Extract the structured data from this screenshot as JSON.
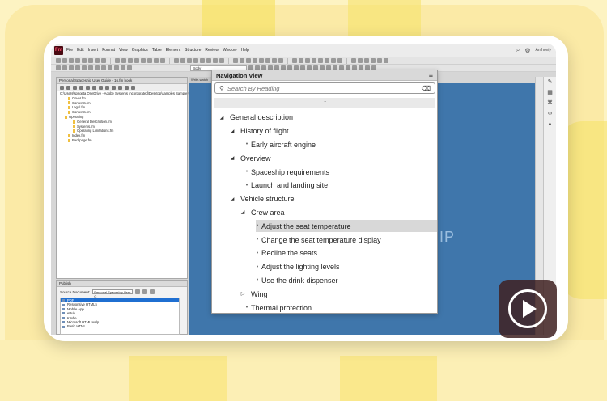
{
  "app": {
    "logo_text": "Fm",
    "menu": [
      "File",
      "Edit",
      "Insert",
      "Format",
      "View",
      "Graphics",
      "Table",
      "Element",
      "Structure",
      "Review",
      "Window",
      "Help"
    ],
    "user": "Anthoniy"
  },
  "toolbar": {
    "paragraph_style": "Body"
  },
  "book_panel": {
    "title": "Personal Spaceship User Guide - 16.fm book",
    "items": [
      "C:\\Users\\sprigeta OneDrive - Adobe Systems Incorporated\\Desktop\\samples Sample User Guide",
      "Cover.fm",
      "Contents.fm",
      "Legal.fm",
      "Contents.fm",
      "Operating",
      "General Description.fm",
      "Systems.fm",
      "Operating Limitations.fm",
      "Index.fm",
      "Backpage.fm"
    ]
  },
  "publish_panel": {
    "title": "Publish",
    "source_label": "Source Document:",
    "source_value": "Personal Spaceship User G",
    "outputs": [
      "PDF",
      "Responsive HTML5",
      "Mobile App",
      "ePub",
      "Kindle",
      "Microsoft HTML Help",
      "Basic HTML"
    ]
  },
  "document": {
    "tab": "Write-watch",
    "background_text": "IP"
  },
  "nav_view": {
    "title": "Navigation View",
    "search_placeholder": "Search By Heading",
    "tree": [
      {
        "label": "General description",
        "level": 0,
        "toggle": "expanded"
      },
      {
        "label": "History of flight",
        "level": 1,
        "toggle": "expanded"
      },
      {
        "label": "Early aircraft engine",
        "level": 2,
        "toggle": "leaf"
      },
      {
        "label": "Overview",
        "level": 1,
        "toggle": "expanded"
      },
      {
        "label": "Spaceship requirements",
        "level": 2,
        "toggle": "leaf"
      },
      {
        "label": "Launch and landing site",
        "level": 2,
        "toggle": "leaf"
      },
      {
        "label": "Vehicle structure",
        "level": 1,
        "toggle": "expanded"
      },
      {
        "label": "Crew area",
        "level": 2,
        "toggle": "expanded"
      },
      {
        "label": "Adjust the seat temperature",
        "level": 3,
        "toggle": "leaf",
        "selected": true
      },
      {
        "label": "Change the seat temperature display",
        "level": 3,
        "toggle": "leaf"
      },
      {
        "label": "Recline the seats",
        "level": 3,
        "toggle": "leaf"
      },
      {
        "label": "Adjust the lighting levels",
        "level": 3,
        "toggle": "leaf"
      },
      {
        "label": "Use the drink dispenser",
        "level": 3,
        "toggle": "leaf"
      },
      {
        "label": "Wing",
        "level": 2,
        "toggle": "collapsed"
      },
      {
        "label": "Thermal protection",
        "level": 2,
        "toggle": "leaf"
      }
    ]
  },
  "colors": {
    "document_blue": "#3f76ab",
    "selection": "#d8d8d8",
    "backdrop": "#fdf3c2"
  }
}
